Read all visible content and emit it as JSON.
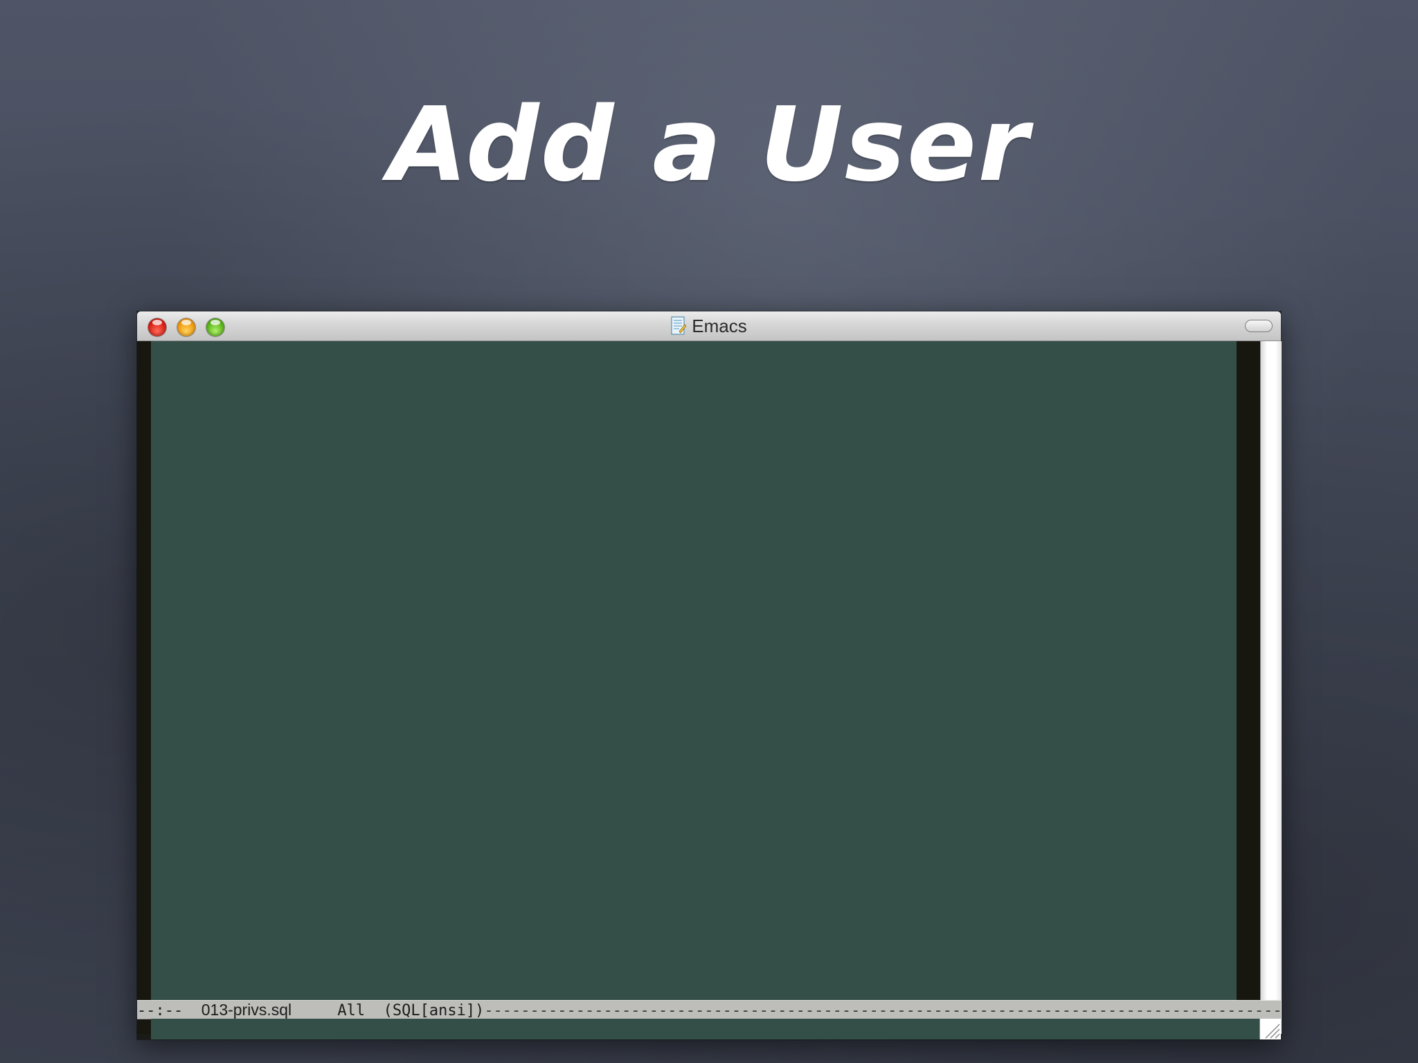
{
  "slide": {
    "title": "Add a User"
  },
  "window": {
    "title": "Emacs",
    "title_icon": "document-icon",
    "buttons": {
      "close": "close-button",
      "minimize": "minimize-button",
      "zoom": "zoom-button"
    }
  },
  "modeline": {
    "status": "--:--",
    "filename": "013-privs.sql",
    "position": "All",
    "mode": "(SQL[ansi])",
    "fill": "-------------------------------------------------------------------------------------------------------------"
  },
  "colors": {
    "editor_bg": "#344f47",
    "fringe": "#17160f",
    "modeline_bg": "#bdbdb9",
    "background": "#464c5c"
  }
}
